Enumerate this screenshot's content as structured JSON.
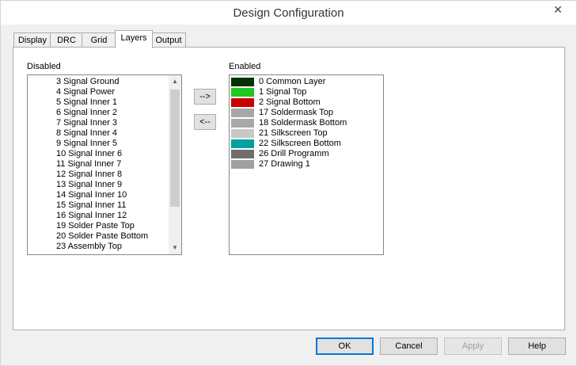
{
  "window": {
    "title": "Design Configuration",
    "close_glyph": "✕"
  },
  "tabs": [
    {
      "label": "Display"
    },
    {
      "label": "DRC"
    },
    {
      "label": "Grid"
    },
    {
      "label": "Layers"
    },
    {
      "label": "Output"
    }
  ],
  "active_tab": "Layers",
  "disabled_list": {
    "label": "Disabled",
    "items": [
      "3 Signal Ground",
      "4 Signal Power",
      "5 Signal Inner 1",
      "6 Signal Inner 2",
      "7 Signal Inner 3",
      "8 Signal Inner 4",
      "9 Signal Inner 5",
      "10 Signal Inner 6",
      "11 Signal Inner 7",
      "12 Signal Inner 8",
      "13 Signal Inner 9",
      "14 Signal Inner 10",
      "15 Signal Inner 11",
      "16 Signal Inner 12",
      "19 Solder Paste Top",
      "20 Solder Paste Bottom",
      "23 Assembly Top"
    ]
  },
  "move_buttons": {
    "enable": "-->",
    "disable": "<--"
  },
  "enabled_list": {
    "label": "Enabled",
    "items": [
      {
        "label": "0 Common Layer",
        "color": "#003300"
      },
      {
        "label": "1 Signal Top",
        "color": "#1ec81e"
      },
      {
        "label": "2 Signal Bottom",
        "color": "#c80000"
      },
      {
        "label": "17 Soldermask Top",
        "color": "#a8a8a8"
      },
      {
        "label": "18 Soldermask Bottom",
        "color": "#a8a8a8"
      },
      {
        "label": "21 Silkscreen Top",
        "color": "#c8c8c8"
      },
      {
        "label": "22 Silkscreen Bottom",
        "color": "#00a0a0"
      },
      {
        "label": "26 Drill Programm",
        "color": "#6e6e6e"
      },
      {
        "label": "27 Drawing 1",
        "color": "#a0a0a0"
      }
    ]
  },
  "footer": {
    "ok": "OK",
    "cancel": "Cancel",
    "apply": "Apply",
    "help": "Help"
  }
}
